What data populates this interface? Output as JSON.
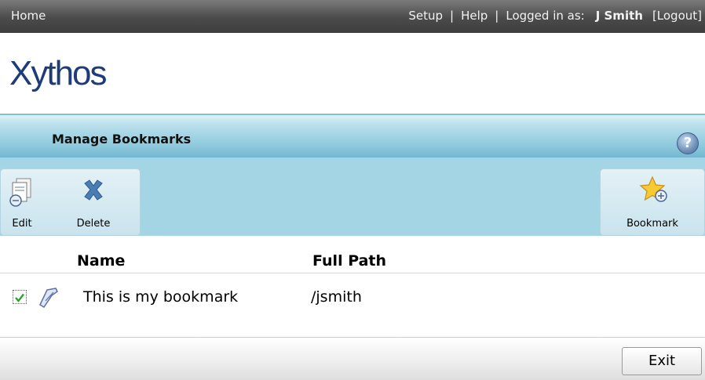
{
  "topbar": {
    "home": "Home",
    "setup": "Setup",
    "help": "Help",
    "logged_in_label": "Logged in as:",
    "user": "J Smith",
    "logout": "[Logout]"
  },
  "brand": {
    "logo": "Xythos"
  },
  "panel": {
    "title": "Manage Bookmarks",
    "help_icon": "?"
  },
  "toolbar": {
    "edit": "Edit",
    "delete": "Delete",
    "bookmark": "Bookmark"
  },
  "table": {
    "columns": [
      "Name",
      "Full Path"
    ],
    "rows": [
      {
        "name": "This is my bookmark",
        "path": "/jsmith",
        "checked": true
      }
    ]
  },
  "footer": {
    "exit": "Exit"
  },
  "colors": {
    "topbar": "#4b4b4b",
    "logo": "#1e3c7a",
    "panel_accent": "#8dc8dc",
    "toolbar_bg": "#a3d5e4"
  }
}
